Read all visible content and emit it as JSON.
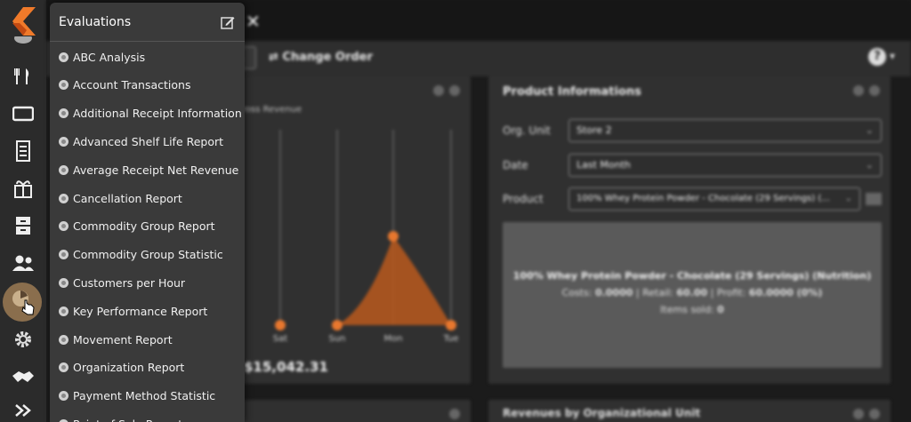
{
  "app": {
    "close_glyph": "✕",
    "toolbar": {
      "change_order": "Change Order",
      "help": "?"
    }
  },
  "rail_icons": [
    "flame-logo",
    "cutlery-icon",
    "register-icon",
    "receipt-icon",
    "gift-icon",
    "cabinet-icon",
    "users-icon",
    "chart-icon",
    "gear-icon",
    "handshake-icon",
    "chevrons-right-icon"
  ],
  "menu": {
    "title": "Evaluations",
    "items": [
      "ABC Analysis",
      "Account Transactions",
      "Additional Receipt Information",
      "Advanced Shelf Life Report",
      "Average Receipt Net Revenue",
      "Cancellation Report",
      "Commodity Group Report",
      "Commodity Group Statistic",
      "Customers per Hour",
      "Key Performance Report",
      "Movement Report",
      "Organization Report",
      "Payment Method Statistic",
      "Point of Sale Report"
    ]
  },
  "revenue_panel": {
    "legend": "ross Revenue",
    "total": "$15,042.31"
  },
  "chart_data": {
    "type": "area",
    "categories": [
      "Sat",
      "Sun",
      "Mon",
      "Tue"
    ],
    "values": [
      0,
      0,
      1,
      0
    ],
    "color": "#e8772e"
  },
  "product_panel": {
    "title": "Product Informations",
    "org_unit_label": "Org. Unit",
    "org_unit_value": "Store 2",
    "date_label": "Date",
    "date_value": "Last Month",
    "product_label": "Product",
    "product_value": "100% Whey Protein Powder - Chocolate (29 Servings) (...",
    "card_name": "100% Whey Protein Powder - Chocolate (29 Servings) (Nutrition)",
    "costs_label": "Costs:",
    "costs": "0.0000",
    "retail_label": "Retail:",
    "retail": "60.00",
    "profit_label": "Profit:",
    "profit": "60.0000 (0%)",
    "items_sold_label": "Items sold:",
    "items_sold": "0"
  },
  "bottom_right_panel": {
    "title": "Revenues by Organizational Unit"
  },
  "colors": {
    "accent": "#e8772e",
    "menu_bg": "#3a3a3a"
  }
}
